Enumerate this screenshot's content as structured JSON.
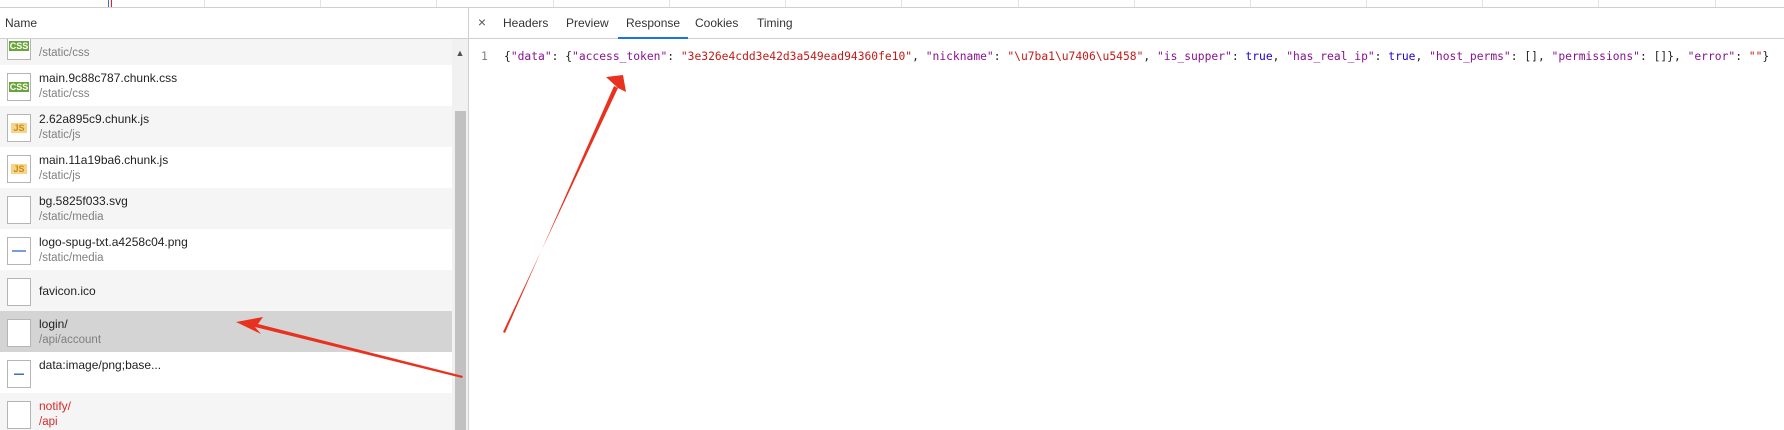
{
  "network": {
    "name_header": "Name",
    "requests": [
      {
        "name": "",
        "path": "/static/css",
        "icon": "css-file-icon"
      },
      {
        "name": "main.9c88c787.chunk.css",
        "path": "/static/css",
        "icon": "css-file-icon"
      },
      {
        "name": "2.62a895c9.chunk.js",
        "path": "/static/js",
        "icon": "js-file-icon"
      },
      {
        "name": "main.11a19ba6.chunk.js",
        "path": "/static/js",
        "icon": "js-file-icon"
      },
      {
        "name": "bg.5825f033.svg",
        "path": "/static/media",
        "icon": "blank-file-icon"
      },
      {
        "name": "logo-spug-txt.a4258c04.png",
        "path": "/static/media",
        "icon": "image-file-icon"
      },
      {
        "name": "favicon.ico",
        "path": "",
        "icon": "blank-file-icon"
      },
      {
        "name": "login/",
        "path": "/api/account",
        "icon": "blank-file-icon",
        "selected": true
      },
      {
        "name": "data:image/png;base...",
        "path": "",
        "icon": "image-file-icon"
      },
      {
        "name": "notify/",
        "path": "/api",
        "icon": "blank-file-icon",
        "error": true
      }
    ]
  },
  "details": {
    "close_glyph": "×",
    "tabs": [
      "Headers",
      "Preview",
      "Response",
      "Cookies",
      "Timing"
    ],
    "active_tab": "Response",
    "line_number": "1",
    "response": {
      "p1": "{",
      "k_data": "\"data\"",
      "p2": ": {",
      "k_token": "\"access_token\"",
      "p3": ": ",
      "v_token": "\"3e326e4cdd3e42d3a549ead94360fe10\"",
      "p4": ", ",
      "k_nick": "\"nickname\"",
      "p5": ": ",
      "v_nick": "\"\\u7ba1\\u7406\\u5458\"",
      "p6": ", ",
      "k_supper": "\"is_supper\"",
      "p7": ": ",
      "v_supper": "true",
      "p8": ", ",
      "k_realip": "\"has_real_ip\"",
      "p9": ": ",
      "v_realip": "true",
      "p10": ", ",
      "k_hostperms": "\"host_perms\"",
      "p11": ": [], ",
      "k_perms": "\"permissions\"",
      "p12": ": []}, ",
      "k_error": "\"error\"",
      "p13": ": ",
      "v_error": "\"\"",
      "p14": "}"
    }
  },
  "colors": {
    "accent": "#1a73e8",
    "error_text": "#d62b2b",
    "annotation_arrow": "#e8321f"
  }
}
